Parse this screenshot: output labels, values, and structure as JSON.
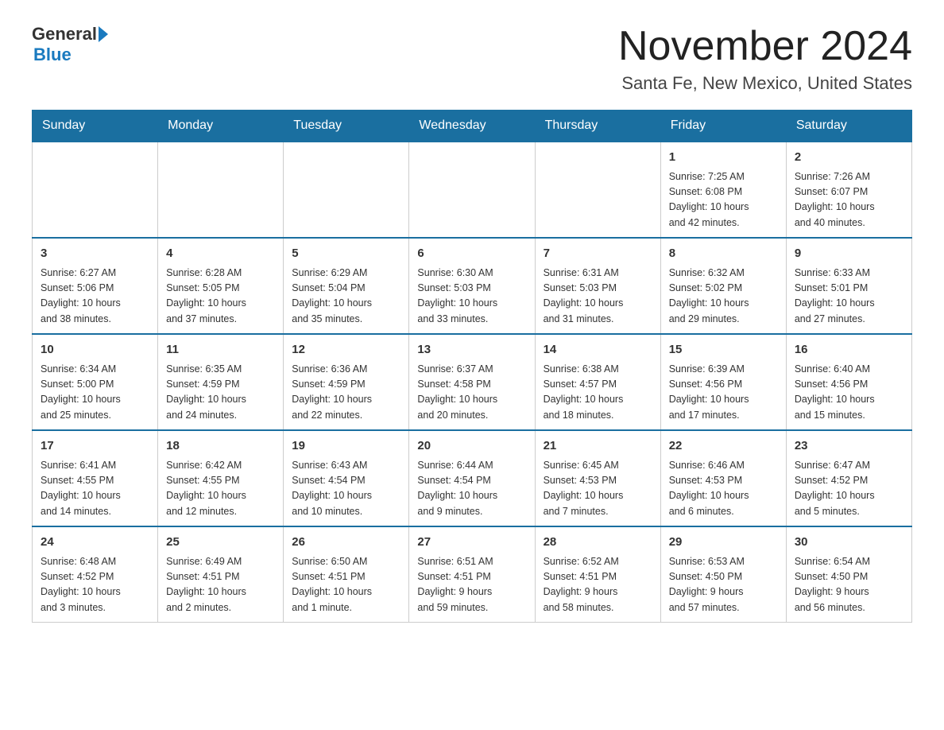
{
  "header": {
    "logo_general": "General",
    "logo_blue": "Blue",
    "title": "November 2024",
    "subtitle": "Santa Fe, New Mexico, United States"
  },
  "weekdays": [
    "Sunday",
    "Monday",
    "Tuesday",
    "Wednesday",
    "Thursday",
    "Friday",
    "Saturday"
  ],
  "rows": [
    [
      {
        "day": "",
        "info": ""
      },
      {
        "day": "",
        "info": ""
      },
      {
        "day": "",
        "info": ""
      },
      {
        "day": "",
        "info": ""
      },
      {
        "day": "",
        "info": ""
      },
      {
        "day": "1",
        "info": "Sunrise: 7:25 AM\nSunset: 6:08 PM\nDaylight: 10 hours\nand 42 minutes."
      },
      {
        "day": "2",
        "info": "Sunrise: 7:26 AM\nSunset: 6:07 PM\nDaylight: 10 hours\nand 40 minutes."
      }
    ],
    [
      {
        "day": "3",
        "info": "Sunrise: 6:27 AM\nSunset: 5:06 PM\nDaylight: 10 hours\nand 38 minutes."
      },
      {
        "day": "4",
        "info": "Sunrise: 6:28 AM\nSunset: 5:05 PM\nDaylight: 10 hours\nand 37 minutes."
      },
      {
        "day": "5",
        "info": "Sunrise: 6:29 AM\nSunset: 5:04 PM\nDaylight: 10 hours\nand 35 minutes."
      },
      {
        "day": "6",
        "info": "Sunrise: 6:30 AM\nSunset: 5:03 PM\nDaylight: 10 hours\nand 33 minutes."
      },
      {
        "day": "7",
        "info": "Sunrise: 6:31 AM\nSunset: 5:03 PM\nDaylight: 10 hours\nand 31 minutes."
      },
      {
        "day": "8",
        "info": "Sunrise: 6:32 AM\nSunset: 5:02 PM\nDaylight: 10 hours\nand 29 minutes."
      },
      {
        "day": "9",
        "info": "Sunrise: 6:33 AM\nSunset: 5:01 PM\nDaylight: 10 hours\nand 27 minutes."
      }
    ],
    [
      {
        "day": "10",
        "info": "Sunrise: 6:34 AM\nSunset: 5:00 PM\nDaylight: 10 hours\nand 25 minutes."
      },
      {
        "day": "11",
        "info": "Sunrise: 6:35 AM\nSunset: 4:59 PM\nDaylight: 10 hours\nand 24 minutes."
      },
      {
        "day": "12",
        "info": "Sunrise: 6:36 AM\nSunset: 4:59 PM\nDaylight: 10 hours\nand 22 minutes."
      },
      {
        "day": "13",
        "info": "Sunrise: 6:37 AM\nSunset: 4:58 PM\nDaylight: 10 hours\nand 20 minutes."
      },
      {
        "day": "14",
        "info": "Sunrise: 6:38 AM\nSunset: 4:57 PM\nDaylight: 10 hours\nand 18 minutes."
      },
      {
        "day": "15",
        "info": "Sunrise: 6:39 AM\nSunset: 4:56 PM\nDaylight: 10 hours\nand 17 minutes."
      },
      {
        "day": "16",
        "info": "Sunrise: 6:40 AM\nSunset: 4:56 PM\nDaylight: 10 hours\nand 15 minutes."
      }
    ],
    [
      {
        "day": "17",
        "info": "Sunrise: 6:41 AM\nSunset: 4:55 PM\nDaylight: 10 hours\nand 14 minutes."
      },
      {
        "day": "18",
        "info": "Sunrise: 6:42 AM\nSunset: 4:55 PM\nDaylight: 10 hours\nand 12 minutes."
      },
      {
        "day": "19",
        "info": "Sunrise: 6:43 AM\nSunset: 4:54 PM\nDaylight: 10 hours\nand 10 minutes."
      },
      {
        "day": "20",
        "info": "Sunrise: 6:44 AM\nSunset: 4:54 PM\nDaylight: 10 hours\nand 9 minutes."
      },
      {
        "day": "21",
        "info": "Sunrise: 6:45 AM\nSunset: 4:53 PM\nDaylight: 10 hours\nand 7 minutes."
      },
      {
        "day": "22",
        "info": "Sunrise: 6:46 AM\nSunset: 4:53 PM\nDaylight: 10 hours\nand 6 minutes."
      },
      {
        "day": "23",
        "info": "Sunrise: 6:47 AM\nSunset: 4:52 PM\nDaylight: 10 hours\nand 5 minutes."
      }
    ],
    [
      {
        "day": "24",
        "info": "Sunrise: 6:48 AM\nSunset: 4:52 PM\nDaylight: 10 hours\nand 3 minutes."
      },
      {
        "day": "25",
        "info": "Sunrise: 6:49 AM\nSunset: 4:51 PM\nDaylight: 10 hours\nand 2 minutes."
      },
      {
        "day": "26",
        "info": "Sunrise: 6:50 AM\nSunset: 4:51 PM\nDaylight: 10 hours\nand 1 minute."
      },
      {
        "day": "27",
        "info": "Sunrise: 6:51 AM\nSunset: 4:51 PM\nDaylight: 9 hours\nand 59 minutes."
      },
      {
        "day": "28",
        "info": "Sunrise: 6:52 AM\nSunset: 4:51 PM\nDaylight: 9 hours\nand 58 minutes."
      },
      {
        "day": "29",
        "info": "Sunrise: 6:53 AM\nSunset: 4:50 PM\nDaylight: 9 hours\nand 57 minutes."
      },
      {
        "day": "30",
        "info": "Sunrise: 6:54 AM\nSunset: 4:50 PM\nDaylight: 9 hours\nand 56 minutes."
      }
    ]
  ]
}
